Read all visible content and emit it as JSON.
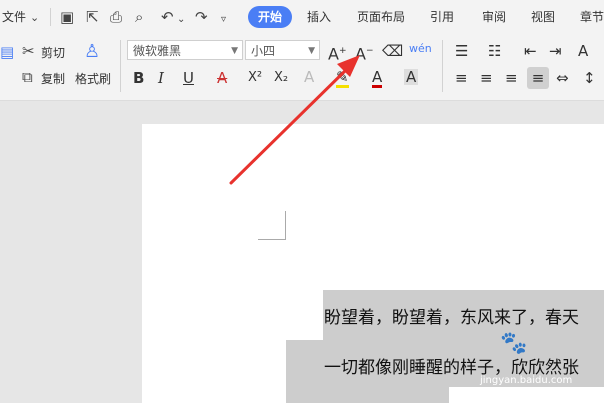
{
  "menu": {
    "file": "文件",
    "active_tab": "开始",
    "tabs": [
      "插入",
      "页面布局",
      "引用",
      "审阅",
      "视图",
      "章节"
    ]
  },
  "clipboard": {
    "cut": "剪切",
    "copy": "复制",
    "format_painter": "格式刷"
  },
  "font": {
    "name": "微软雅黑",
    "size": "小四"
  },
  "format_buttons": {
    "bold": "B",
    "italic": "I",
    "underline": "U",
    "strike": "A",
    "superscript": "X²",
    "subscript": "X₂"
  },
  "document": {
    "line1": "盼望着，盼望着，东风来了，春天",
    "line2": "一切都像刚睡醒的样子，欣欣然张"
  },
  "watermark": {
    "text": "jingyan.baidu.com"
  },
  "colors": {
    "accent": "#4a7ef5",
    "arrow": "#e8322d",
    "highlight": "#cdcdcd"
  }
}
